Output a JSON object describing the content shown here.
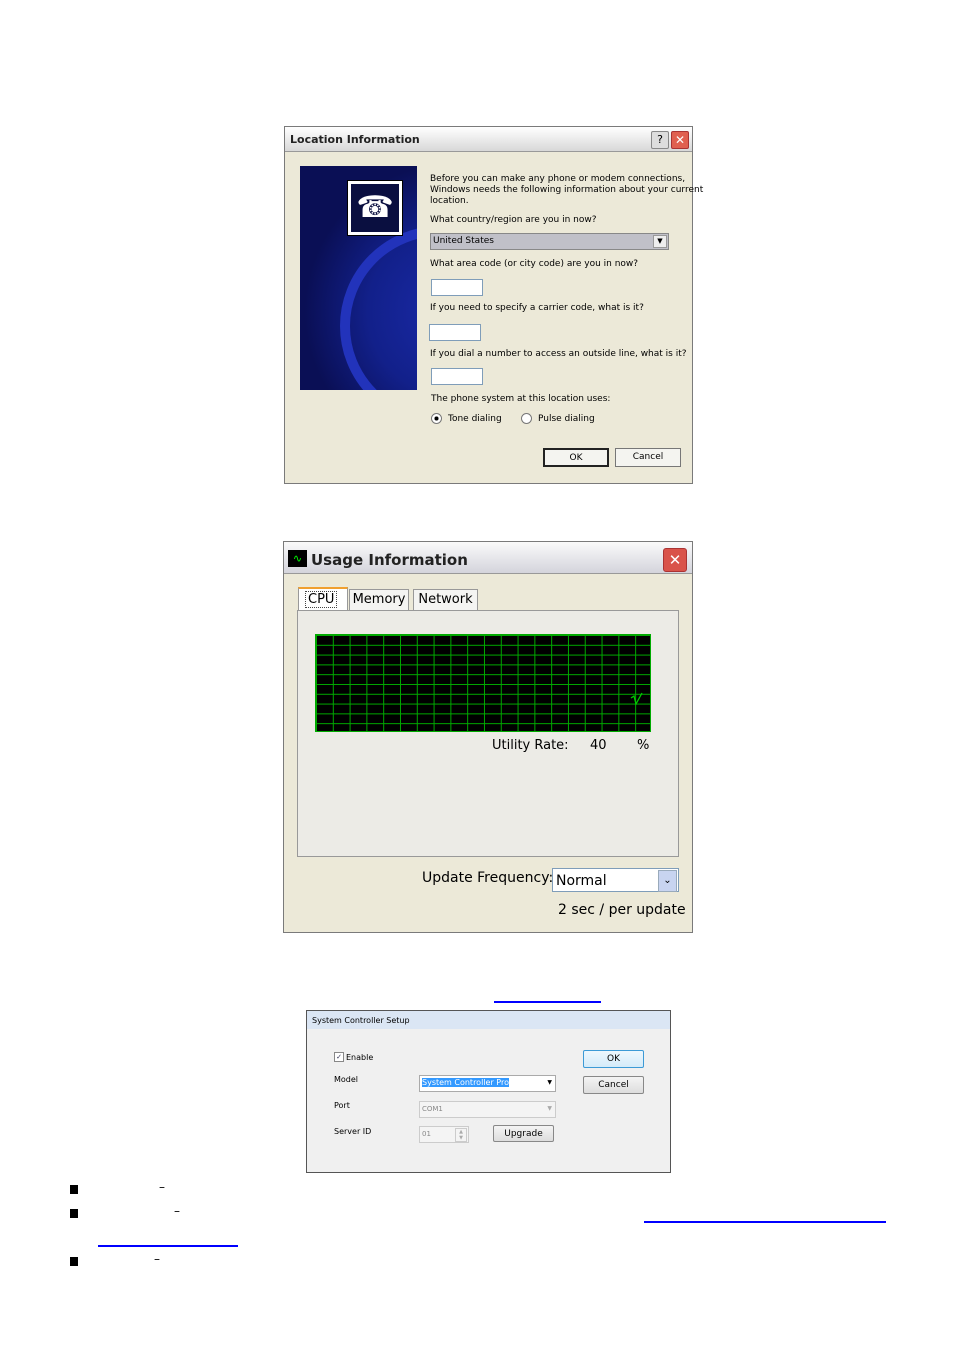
{
  "location_dialog": {
    "title": "Location Information",
    "help_icon": "question-mark-icon",
    "close_icon": "close-x-icon",
    "intro": [
      "Before you can make any phone or modem connections,",
      "Windows needs the following information about your current",
      "location."
    ],
    "country_label": "What country/region are you in now?",
    "country_value": "United States",
    "area_code_label": "What area code (or city code) are you in now?",
    "area_code_value": "",
    "carrier_label": "If you need to specify a carrier code, what is it?",
    "carrier_value": "",
    "outside_line_label": "If you dial a number to access an outside line, what is it?",
    "outside_line_value": "",
    "phone_system_label": "The phone system at this location uses:",
    "tone_label": "Tone dialing",
    "pulse_label": "Pulse dialing",
    "selected_dialing": "Tone dialing",
    "ok_label": "OK",
    "cancel_label": "Cancel"
  },
  "usage_dialog": {
    "title": "Usage Information",
    "tabs": [
      "CPU",
      "Memory",
      "Network"
    ],
    "active_tab": "CPU",
    "utility_label": "Utility Rate:",
    "utility_value": "40",
    "utility_unit": "%",
    "frequency_label": "Update Frequency:",
    "frequency_value": "Normal",
    "interval_text": "2 sec / per update",
    "graph_color": "#00c800"
  },
  "controller_dialog": {
    "title": "System Controller Setup",
    "enable_label": "Enable",
    "enable_checked": true,
    "model_label": "Model",
    "model_value": "System Controller Pro",
    "port_label": "Port",
    "port_value": "COM1",
    "server_id_label": "Server ID",
    "server_id_value": "01",
    "upgrade_label": "Upgrade",
    "ok_label": "OK",
    "cancel_label": "Cancel"
  },
  "bullets": [
    "–",
    "–",
    "–"
  ],
  "link_color": "#0000ff"
}
